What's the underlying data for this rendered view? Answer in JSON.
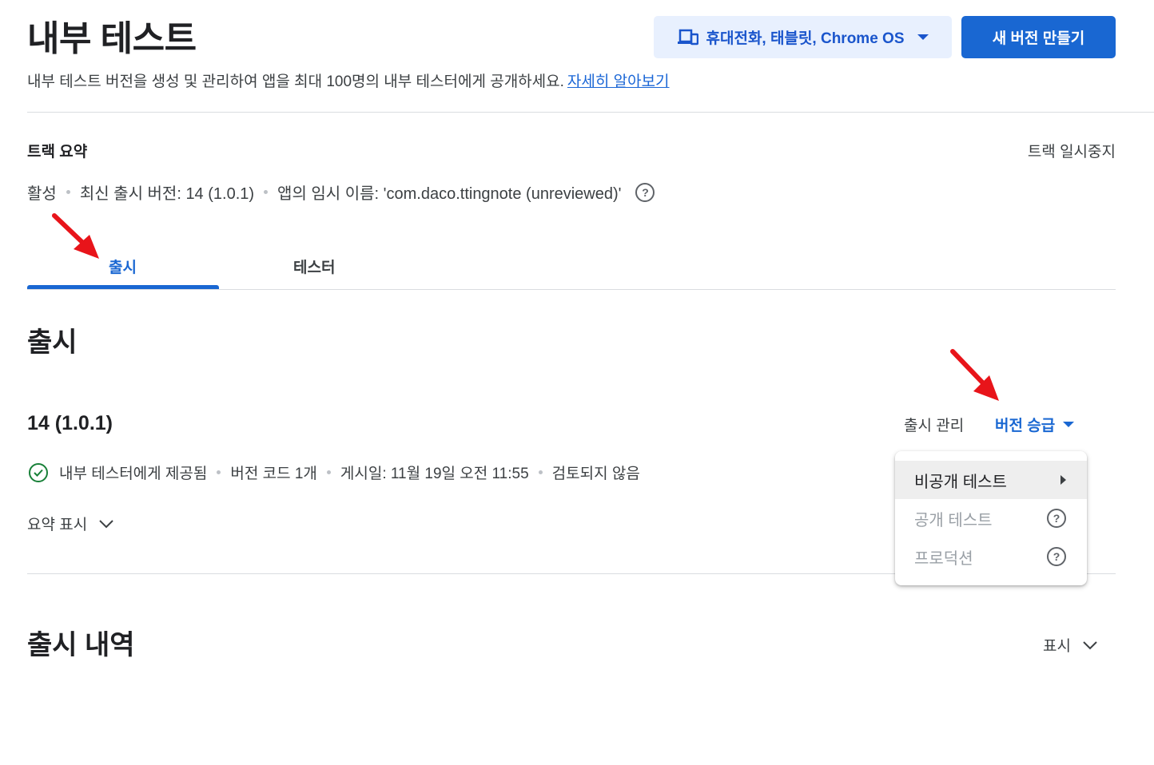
{
  "header": {
    "title": "내부 테스트",
    "subtitle": "내부 테스트 버전을 생성 및 관리하여 앱을 최대 100명의 내부 테스터에게 공개하세요.",
    "learn_more": "자세히 알아보기",
    "device_selector": "휴대전화, 태블릿, Chrome OS",
    "create_release_button": "새 버전 만들기"
  },
  "track_summary": {
    "label": "트랙 요약",
    "pause_track": "트랙 일시중지",
    "status": "활성",
    "latest_release": "최신 출시 버전: 14 (1.0.1)",
    "app_name": "앱의 임시 이름: 'com.daco.ttingnote (unreviewed)'",
    "help": "?"
  },
  "tabs": [
    {
      "label": "출시",
      "active": true
    },
    {
      "label": "테스터",
      "active": false
    }
  ],
  "releases": {
    "heading": "출시",
    "version": "14 (1.0.1)",
    "manage_release": "출시 관리",
    "promote_release": "버전 승급",
    "status": "내부 테스터에게 제공됨",
    "version_codes": "버전 코드 1개",
    "published": "게시일: 11월 19일 오전 11:55",
    "review": "검토되지 않음",
    "show_summary": "요약 표시"
  },
  "promote_menu": {
    "items": [
      {
        "label": "비공개 테스트",
        "state": "enabled",
        "icon": "chevron-right-icon"
      },
      {
        "label": "공개 테스트",
        "state": "disabled",
        "icon": "help-icon"
      },
      {
        "label": "프로덕션",
        "state": "disabled",
        "icon": "help-icon"
      }
    ],
    "help": "?"
  },
  "history": {
    "heading": "출시 내역",
    "show": "표시"
  },
  "colors": {
    "accent": "#1967d2",
    "annotation_arrow": "#e8141a"
  }
}
